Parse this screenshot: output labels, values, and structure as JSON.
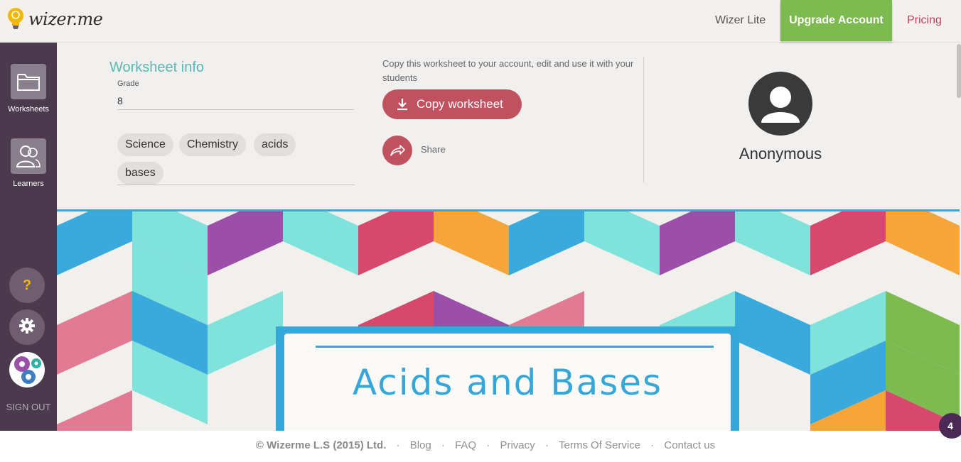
{
  "header": {
    "logo_text": "wizer.me",
    "nav": {
      "lite": "Wizer Lite",
      "upgrade": "Upgrade Account",
      "pricing": "Pricing"
    }
  },
  "sidebar": {
    "items": [
      {
        "label": "Worksheets",
        "icon": "folder-icon"
      },
      {
        "label": "Learners",
        "icon": "users-icon"
      }
    ],
    "help_label": "?",
    "signout": "SIGN OUT"
  },
  "worksheet_info": {
    "title": "Worksheet info",
    "grade_label": "Grade",
    "grade_value": "8",
    "tags": [
      "Science",
      "Chemistry",
      "acids",
      "bases"
    ]
  },
  "copy": {
    "description": "Copy this worksheet to your account, edit and use it with your students",
    "button_label": "Copy worksheet",
    "share_label": "Share"
  },
  "author": {
    "name": "Anonymous"
  },
  "banner": {
    "title": "Acids and Bases"
  },
  "footer": {
    "copyright": "© Wizerme L.S (2015) Ltd.",
    "links": [
      "Blog",
      "FAQ",
      "Privacy",
      "Terms Of Service",
      "Contact us"
    ]
  },
  "notification_count": "4",
  "colors": {
    "accent_teal": "#5ab8b4",
    "upgrade_green": "#7dbb51",
    "pricing_red": "#c0425a",
    "copy_button": "#c0525f",
    "sidebar_bg": "#4b3a4d",
    "banner_blue": "#35a7d8"
  }
}
